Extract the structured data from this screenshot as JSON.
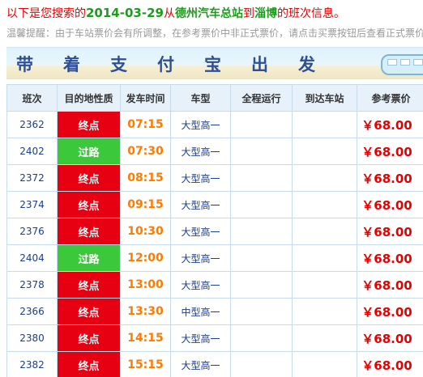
{
  "headline": {
    "prefix": "以下是您搜索的",
    "date": "2014-03-29",
    "from_word": "从",
    "origin": "德州汽车总站",
    "to_word": "到",
    "destination": "淄博",
    "suffix": "的班次信息。"
  },
  "notice": "温馨提醒：由于车站票价会有所调整，在参考票价中非正式票价，请点击买票按钮后查看正式票价",
  "banner": {
    "chars": [
      "带",
      "着",
      "支",
      "付",
      "宝",
      "出",
      "发"
    ]
  },
  "table": {
    "headers": [
      "班次",
      "目的地性质",
      "发车时间",
      "车型",
      "全程运行",
      "到达车站",
      "参考票价"
    ],
    "rows": [
      {
        "num": "2362",
        "nature": "终点",
        "nature_kind": "end",
        "time": "07:15",
        "type": "大型高一",
        "duration": "",
        "arrive": "",
        "price": "￥68.00"
      },
      {
        "num": "2402",
        "nature": "过路",
        "nature_kind": "pass",
        "time": "07:30",
        "type": "大型高一",
        "duration": "",
        "arrive": "",
        "price": "￥68.00"
      },
      {
        "num": "2372",
        "nature": "终点",
        "nature_kind": "end",
        "time": "08:15",
        "type": "大型高一",
        "duration": "",
        "arrive": "",
        "price": "￥68.00"
      },
      {
        "num": "2374",
        "nature": "终点",
        "nature_kind": "end",
        "time": "09:15",
        "type": "大型高一",
        "duration": "",
        "arrive": "",
        "price": "￥68.00"
      },
      {
        "num": "2376",
        "nature": "终点",
        "nature_kind": "end",
        "time": "10:30",
        "type": "大型高一",
        "duration": "",
        "arrive": "",
        "price": "￥68.00"
      },
      {
        "num": "2404",
        "nature": "过路",
        "nature_kind": "pass",
        "time": "12:00",
        "type": "大型高一",
        "duration": "",
        "arrive": "",
        "price": "￥68.00"
      },
      {
        "num": "2378",
        "nature": "终点",
        "nature_kind": "end",
        "time": "13:00",
        "type": "大型高一",
        "duration": "",
        "arrive": "",
        "price": "￥68.00"
      },
      {
        "num": "2366",
        "nature": "终点",
        "nature_kind": "end",
        "time": "13:30",
        "type": "中型高一",
        "duration": "",
        "arrive": "",
        "price": "￥68.00"
      },
      {
        "num": "2380",
        "nature": "终点",
        "nature_kind": "end",
        "time": "14:15",
        "type": "大型高一",
        "duration": "",
        "arrive": "",
        "price": "￥68.00"
      },
      {
        "num": "2382",
        "nature": "终点",
        "nature_kind": "end",
        "time": "15:15",
        "type": "大型高一",
        "duration": "",
        "arrive": "",
        "price": "￥68.00"
      }
    ]
  },
  "colors": {
    "end": "#e60012",
    "pass": "#3bc93b",
    "time": "#ff7a00",
    "price": "#e60000",
    "link": "#1a3e8f"
  }
}
